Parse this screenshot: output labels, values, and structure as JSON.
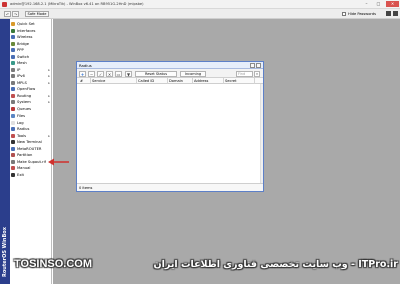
{
  "window": {
    "title": "admin@192.168.2.1 (MikroTik) - WinBox v6.41 on RB951G-2HnD (mipsbe)",
    "close_glyph": "✕",
    "min_glyph": "–",
    "max_glyph": "□"
  },
  "toolbar": {
    "undo_glyph": "↶",
    "redo_glyph": "↷",
    "safe_mode_label": "Safe Mode",
    "hide_passwords_label": "Hide Passwords",
    "hide_passwords_checked": false
  },
  "brand": {
    "vertical_text": "RouterOS WinBox"
  },
  "sidebar": {
    "items": [
      {
        "label": "Quick Set",
        "icon": "quickset-icon",
        "color": "#d99a2b",
        "submenu": false
      },
      {
        "label": "Interfaces",
        "icon": "interfaces-icon",
        "color": "#3a7a3a",
        "submenu": false
      },
      {
        "label": "Wireless",
        "icon": "wireless-icon",
        "color": "#4a6fb5",
        "submenu": false
      },
      {
        "label": "Bridge",
        "icon": "bridge-icon",
        "color": "#6a8a3a",
        "submenu": false
      },
      {
        "label": "PPP",
        "icon": "ppp-icon",
        "color": "#4a6fb5",
        "submenu": false
      },
      {
        "label": "Switch",
        "icon": "switch-icon",
        "color": "#4a6fb5",
        "submenu": false
      },
      {
        "label": "Mesh",
        "icon": "mesh-icon",
        "color": "#3a9a8a",
        "submenu": false
      },
      {
        "label": "IP",
        "icon": "ip-icon",
        "color": "#7a7a7a",
        "submenu": true
      },
      {
        "label": "IPv6",
        "icon": "ipv6-icon",
        "color": "#7a7a7a",
        "submenu": true
      },
      {
        "label": "MPLS",
        "icon": "mpls-icon",
        "color": "#7a7a7a",
        "submenu": true
      },
      {
        "label": "OpenFlow",
        "icon": "openflow-icon",
        "color": "#4a6fb5",
        "submenu": false
      },
      {
        "label": "Routing",
        "icon": "routing-icon",
        "color": "#c05050",
        "submenu": true
      },
      {
        "label": "System",
        "icon": "system-icon",
        "color": "#7a7a7a",
        "submenu": true
      },
      {
        "label": "Queues",
        "icon": "queues-icon",
        "color": "#b83a3a",
        "submenu": false
      },
      {
        "label": "Files",
        "icon": "files-icon",
        "color": "#5a86c4",
        "submenu": false
      },
      {
        "label": "Log",
        "icon": "log-icon",
        "color": "#e0e0e0",
        "submenu": false
      },
      {
        "label": "Radius",
        "icon": "radius-icon",
        "color": "#4a6fb5",
        "submenu": false
      },
      {
        "label": "Tools",
        "icon": "tools-icon",
        "color": "#c05050",
        "submenu": true
      },
      {
        "label": "New Terminal",
        "icon": "terminal-icon",
        "color": "#333333",
        "submenu": false
      },
      {
        "label": "MetaROUTER",
        "icon": "metarouter-icon",
        "color": "#4a6fb5",
        "submenu": false
      },
      {
        "label": "Partition",
        "icon": "partition-icon",
        "color": "#b05050",
        "submenu": false
      },
      {
        "label": "Make Supout.rif",
        "icon": "supout-icon",
        "color": "#7a7a7a",
        "submenu": false
      },
      {
        "label": "Manual",
        "icon": "manual-icon",
        "color": "#c05050",
        "submenu": false
      },
      {
        "label": "Exit",
        "icon": "exit-icon",
        "color": "#333333",
        "submenu": false
      }
    ]
  },
  "radius_window": {
    "title": "Radius",
    "tools": {
      "add_glyph": "+",
      "remove_glyph": "−",
      "enable_glyph": "✓",
      "disable_glyph": "✕",
      "copy_glyph": "▭",
      "filter_glyph": "▼",
      "reset_status_label": "Reset Status",
      "incoming_label": "Incoming",
      "find_placeholder": "Find"
    },
    "columns": [
      "#",
      "Service",
      "Called ID",
      "Domain",
      "Address",
      "Secret"
    ],
    "status_text": "0 items"
  },
  "watermark": {
    "english": "TOSINSO.COM",
    "persian": "ITPro.ir - وب سایت تخصصی فناوری اطلاعات ایران"
  },
  "colors": {
    "brand_strip": "#2b3e8c",
    "desktop": "#a9a9a9",
    "arrow": "#d0312d"
  }
}
